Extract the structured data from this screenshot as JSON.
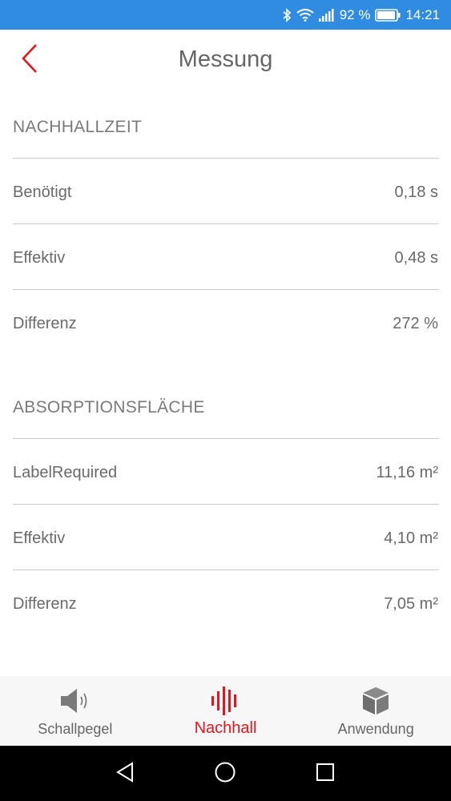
{
  "status_bar": {
    "battery_percent": "92 %",
    "time": "14:21"
  },
  "header": {
    "title": "Messung"
  },
  "sections": [
    {
      "title": "NACHHALLZEIT",
      "rows": [
        {
          "label": "Benötigt",
          "value": "0,18 s"
        },
        {
          "label": "Effektiv",
          "value": "0,48 s"
        },
        {
          "label": "Differenz",
          "value": "272 %"
        }
      ]
    },
    {
      "title": "ABSORPTIONSFLÄCHE",
      "rows": [
        {
          "label": "LabelRequired",
          "value": "11,16 m²"
        },
        {
          "label": "Effektiv",
          "value": "4,10 m²"
        },
        {
          "label": "Differenz",
          "value": "7,05 m²"
        }
      ]
    }
  ],
  "bottom_nav": {
    "items": [
      {
        "label": "Schallpegel",
        "icon": "speaker-icon"
      },
      {
        "label": "Nachhall",
        "icon": "sound-wave-icon"
      },
      {
        "label": "Anwendung",
        "icon": "cube-icon"
      }
    ],
    "active_index": 1
  },
  "colors": {
    "status_bar": "#2f8ce0",
    "accent": "#e3161e",
    "text": "#666666",
    "divider": "#c8c8c8"
  }
}
